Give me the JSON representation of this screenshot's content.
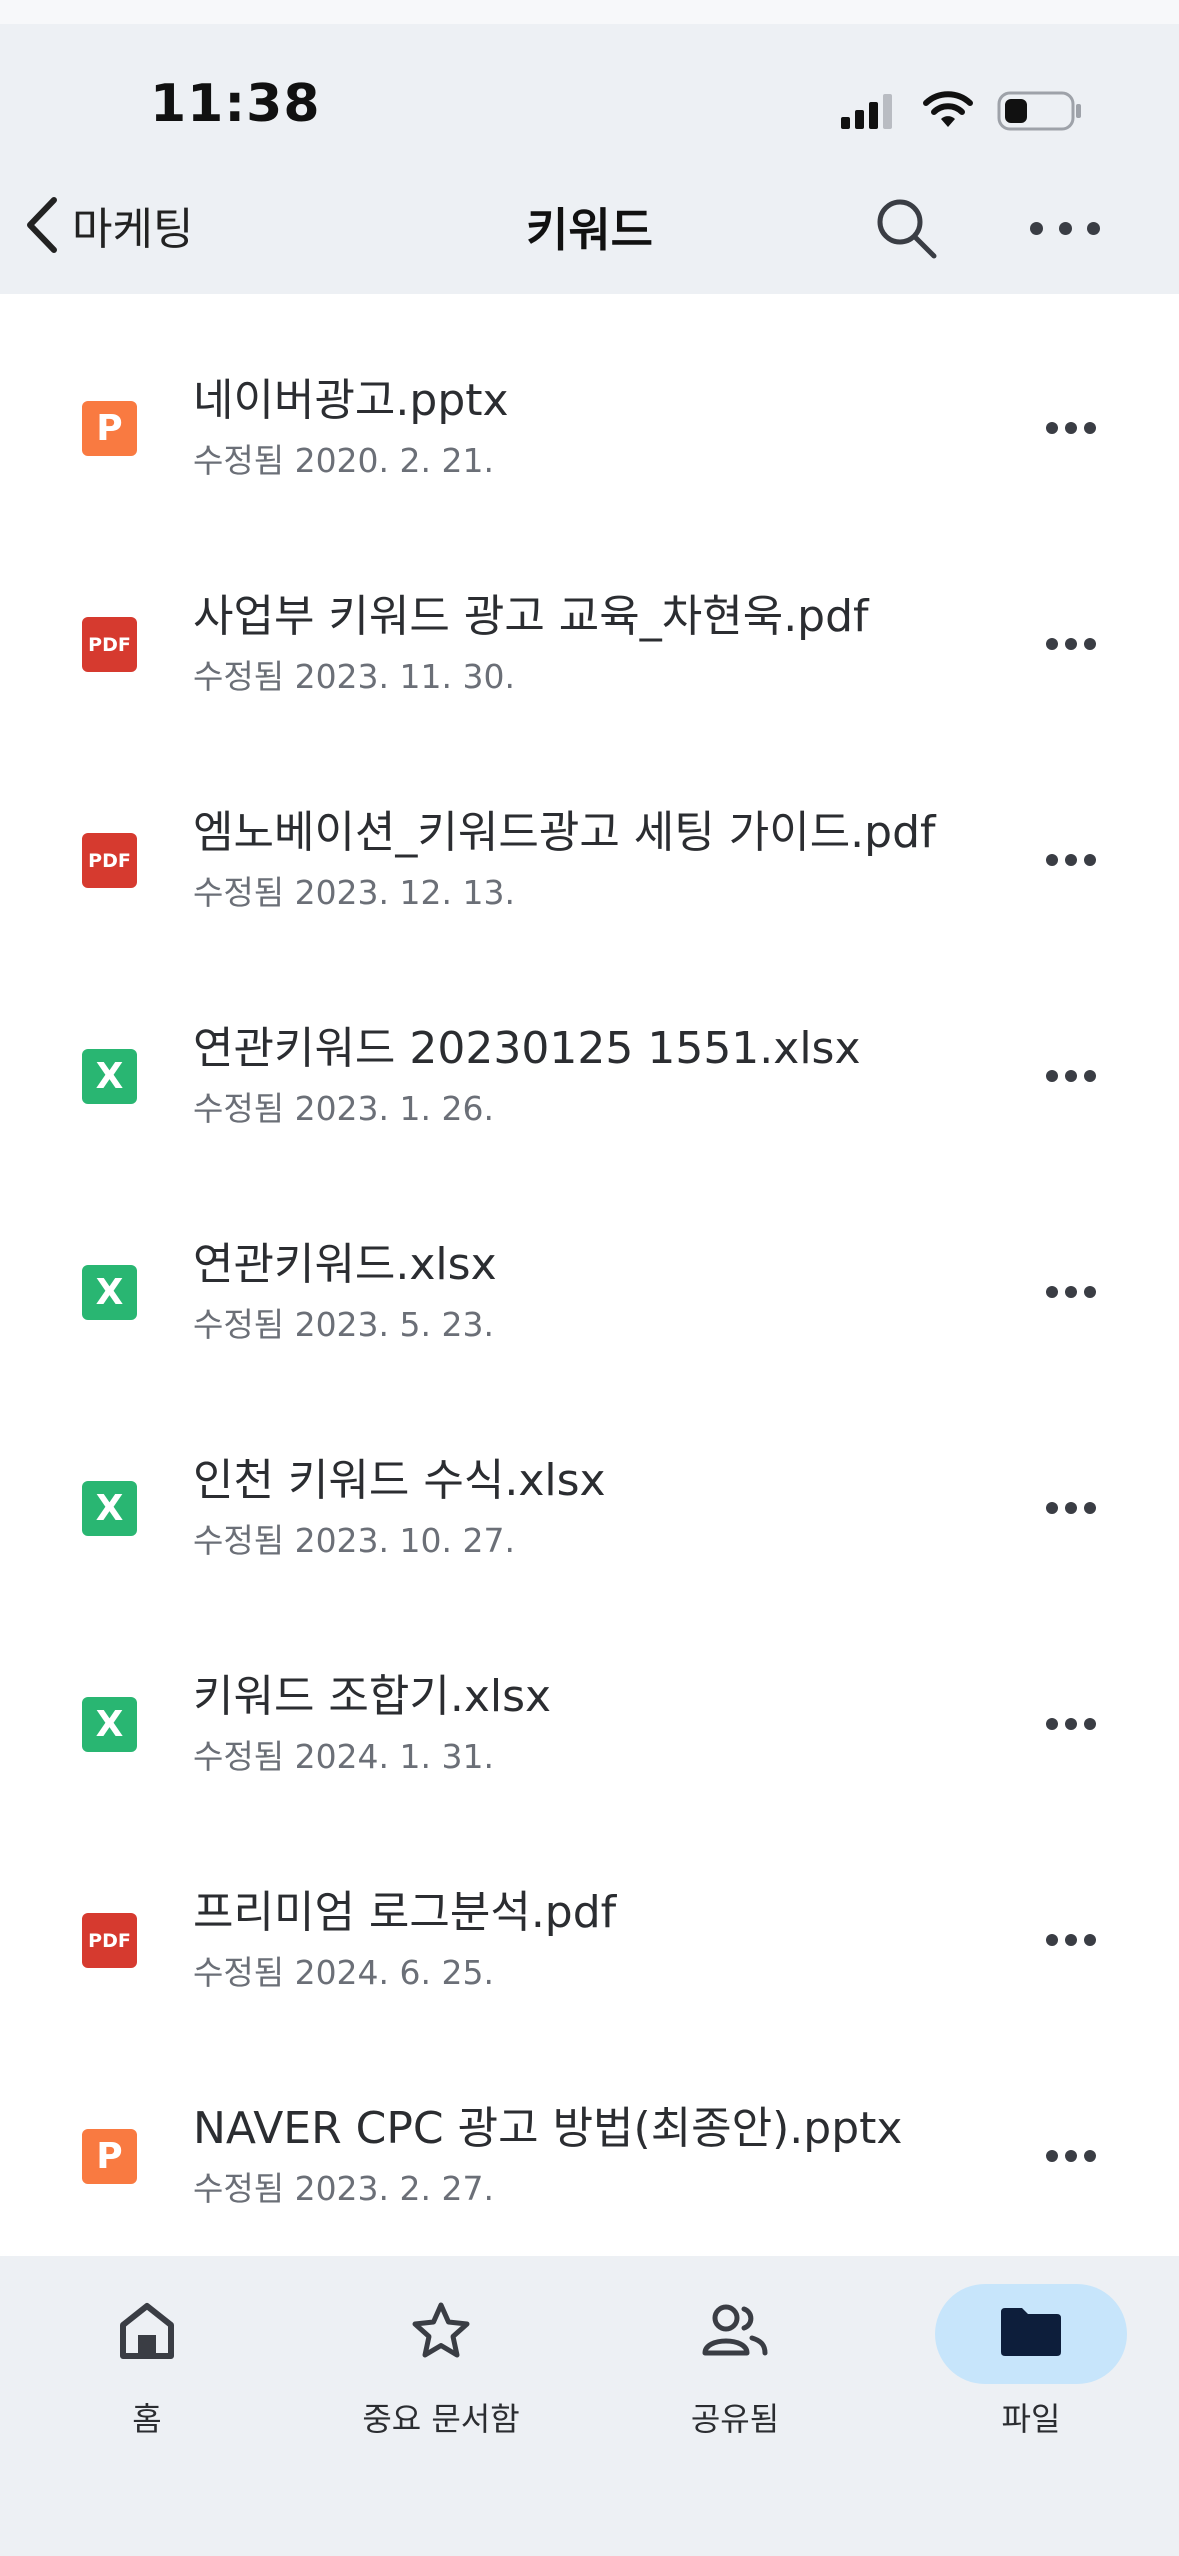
{
  "status_bar": {
    "time": "11:38"
  },
  "nav": {
    "back_label": "마케팅",
    "title": "키워드"
  },
  "files": [
    {
      "name": "네이버광고.pptx",
      "modified": "수정됨 2020. 2. 21.",
      "icon": "P",
      "type": "pptx"
    },
    {
      "name": "사업부 키워드 광고 교육_차현욱.pdf",
      "modified": "수정됨 2023. 11. 30.",
      "icon": "PDF",
      "type": "pdf"
    },
    {
      "name": "엠노베이션_키워드광고 세팅 가이드.pdf",
      "modified": "수정됨 2023. 12. 13.",
      "icon": "PDF",
      "type": "pdf"
    },
    {
      "name": "연관키워드 20230125 1551.xlsx",
      "modified": "수정됨 2023. 1. 26.",
      "icon": "X",
      "type": "xlsx"
    },
    {
      "name": "연관키워드.xlsx",
      "modified": "수정됨 2023. 5. 23.",
      "icon": "X",
      "type": "xlsx"
    },
    {
      "name": "인천 키워드 수식.xlsx",
      "modified": "수정됨 2023. 10. 27.",
      "icon": "X",
      "type": "xlsx"
    },
    {
      "name": "키워드 조합기.xlsx",
      "modified": "수정됨 2024. 1. 31.",
      "icon": "X",
      "type": "xlsx"
    },
    {
      "name": "프리미엄 로그분석.pdf",
      "modified": "수정됨 2024. 6. 25.",
      "icon": "PDF",
      "type": "pdf"
    },
    {
      "name": "NAVER CPC 광고 방법(최종안).pptx",
      "modified": "수정됨 2023. 2. 27.",
      "icon": "P",
      "type": "pptx"
    }
  ],
  "tabs": [
    {
      "label": "홈",
      "icon": "home-icon"
    },
    {
      "label": "중요 문서함",
      "icon": "star-icon"
    },
    {
      "label": "공유됨",
      "icon": "people-icon"
    },
    {
      "label": "파일",
      "icon": "folder-icon",
      "active": true
    }
  ],
  "colors": {
    "pptx": "#f97a41",
    "pdf": "#d63a2f",
    "xlsx": "#29b672",
    "active_tab": "#c7e5fb",
    "header_bg": "#edf0f4"
  }
}
